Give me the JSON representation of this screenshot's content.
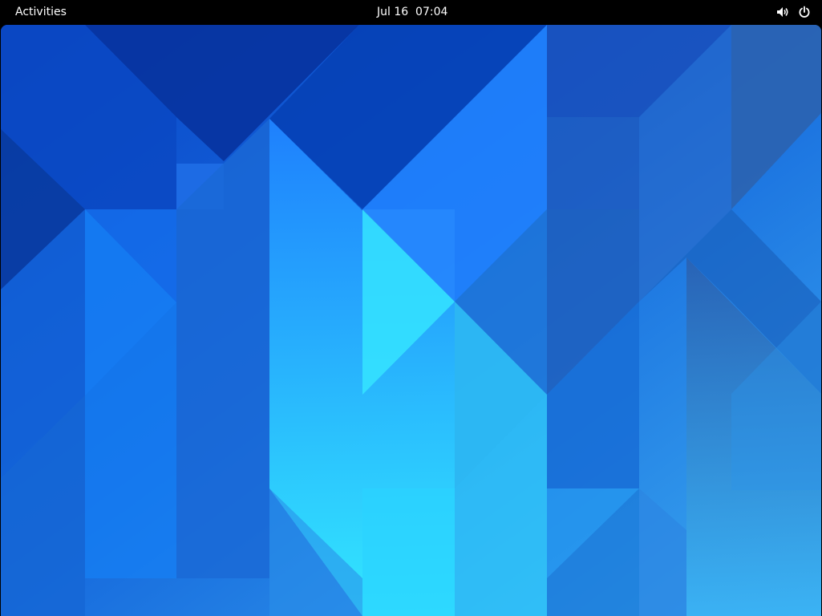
{
  "top_bar": {
    "activities_label": "Activities",
    "clock_label": "Jul 16  07:04",
    "icons": [
      "volume-icon",
      "power-icon"
    ]
  },
  "wallpaper": {
    "colors": {
      "deep": "#0735a8",
      "mid": "#1d6fe8",
      "light": "#2ea9f5",
      "cyan": "#33e8ff"
    }
  }
}
